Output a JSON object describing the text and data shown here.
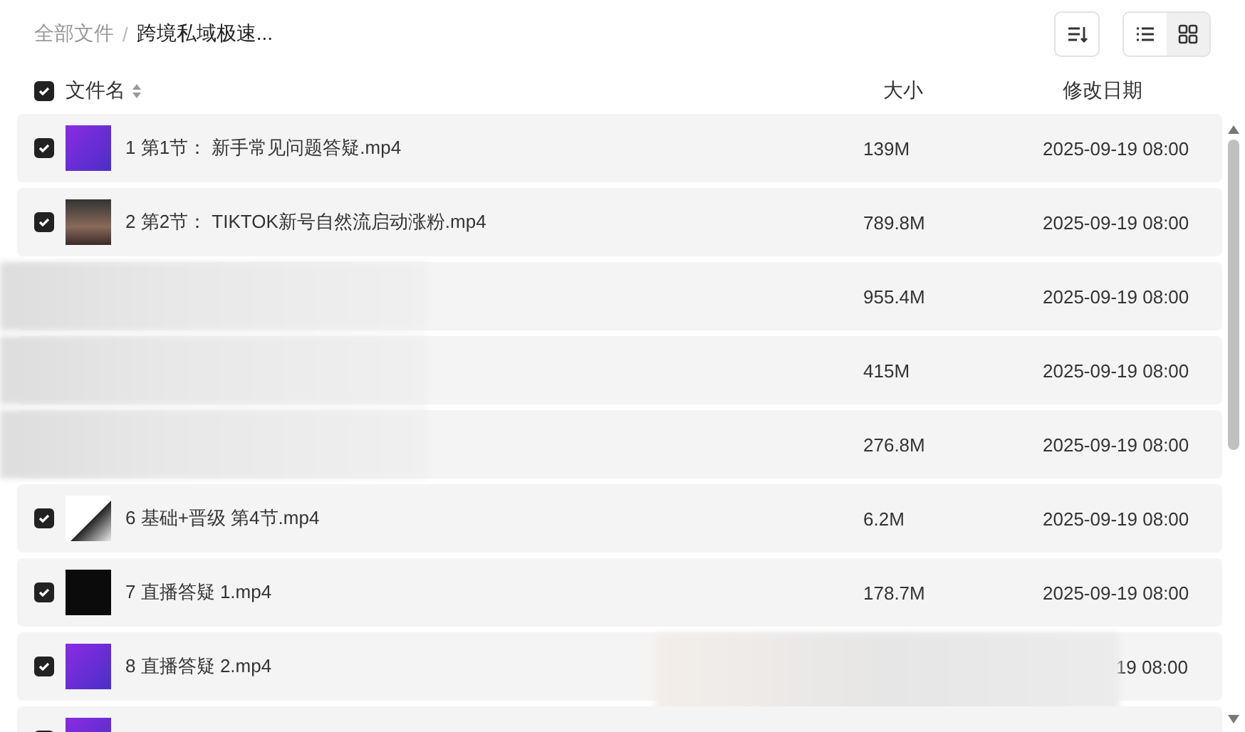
{
  "breadcrumb": {
    "separator": "/",
    "items": [
      {
        "label": "全部文件",
        "current": false
      },
      {
        "label": "跨境私域极速...",
        "current": true
      }
    ]
  },
  "toolbar": {
    "views": [
      {
        "kind": "list",
        "selected": false
      },
      {
        "kind": "grid",
        "selected": true
      }
    ]
  },
  "table": {
    "columns": {
      "name": "文件名",
      "size": "大小",
      "date": "修改日期"
    },
    "all_checked": true,
    "rows": [
      {
        "kind": "file",
        "checked": true,
        "thumbnail": {
          "kind": "gradient"
        },
        "name": "1 第1节： 新手常见问题答疑.mp4",
        "size": "139M",
        "date": "2025-09-19 08:00"
      },
      {
        "kind": "file",
        "checked": true,
        "thumbnail": {
          "kind": "photo"
        },
        "name": "2 第2节： TIKTOK新号自然流启动涨粉.mp4",
        "size": "789.8M",
        "date": "2025-09-19 08:00"
      },
      {
        "kind": "blurred",
        "size": "955.4M",
        "date": "2025-09-19 08:00"
      },
      {
        "kind": "blurred",
        "size": "415M",
        "date": "2025-09-19 08:00"
      },
      {
        "kind": "blurred",
        "size": "276.8M",
        "date": "2025-09-19 08:00"
      },
      {
        "kind": "file",
        "checked": true,
        "thumbnail": {
          "kind": "screen"
        },
        "name": "6 基础+晋级 第4节.mp4",
        "size": "6.2M",
        "date": "2025-09-19 08:00"
      },
      {
        "kind": "file",
        "checked": true,
        "thumbnail": {
          "kind": "dark"
        },
        "name": "7 直播答疑 1.mp4",
        "size": "178.7M",
        "date": "2025-09-19 08:00"
      },
      {
        "kind": "partly_blurred",
        "checked": true,
        "thumbnail": {
          "kind": "gradient"
        },
        "name": "8 直播答疑 2.mp4",
        "date": "19 08:00"
      },
      {
        "kind": "file",
        "checked": true,
        "thumbnail": {
          "kind": "gradient"
        }
      }
    ]
  }
}
